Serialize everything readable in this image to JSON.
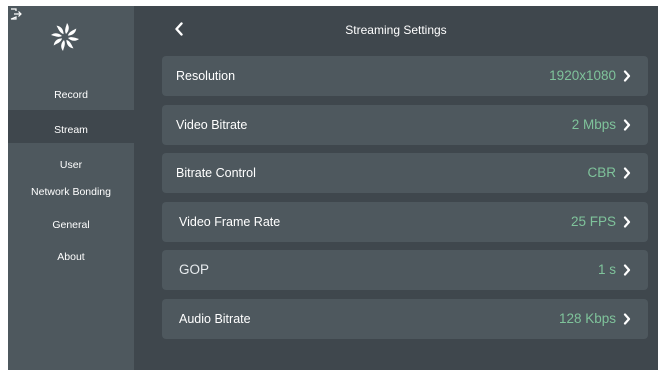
{
  "colors": {
    "background": "#3f474d",
    "panel": "#4e585e",
    "value_text": "#7fc39b",
    "label_text": "#ffffff"
  },
  "sidebar": {
    "icons": [
      "exit-icon",
      "logo-icon"
    ],
    "items": [
      {
        "label": "Record",
        "active": false
      },
      {
        "label": "Stream",
        "active": true
      },
      {
        "label": "User",
        "active": false
      },
      {
        "label": "Network Bonding",
        "active": false
      },
      {
        "label": "General",
        "active": false
      },
      {
        "label": "About",
        "active": false
      }
    ]
  },
  "header": {
    "title": "Streaming Settings",
    "back_icon": "chevron-left-icon"
  },
  "settings": [
    {
      "label": "Resolution",
      "value": "1920x1080"
    },
    {
      "label": "Video Bitrate",
      "value": "2 Mbps"
    },
    {
      "label": "Bitrate Control",
      "value": "CBR"
    },
    {
      "label": "Video Frame Rate",
      "value": "25 FPS"
    },
    {
      "label": "GOP",
      "value": "1 s"
    },
    {
      "label": "Audio Bitrate",
      "value": "128 Kbps"
    }
  ]
}
